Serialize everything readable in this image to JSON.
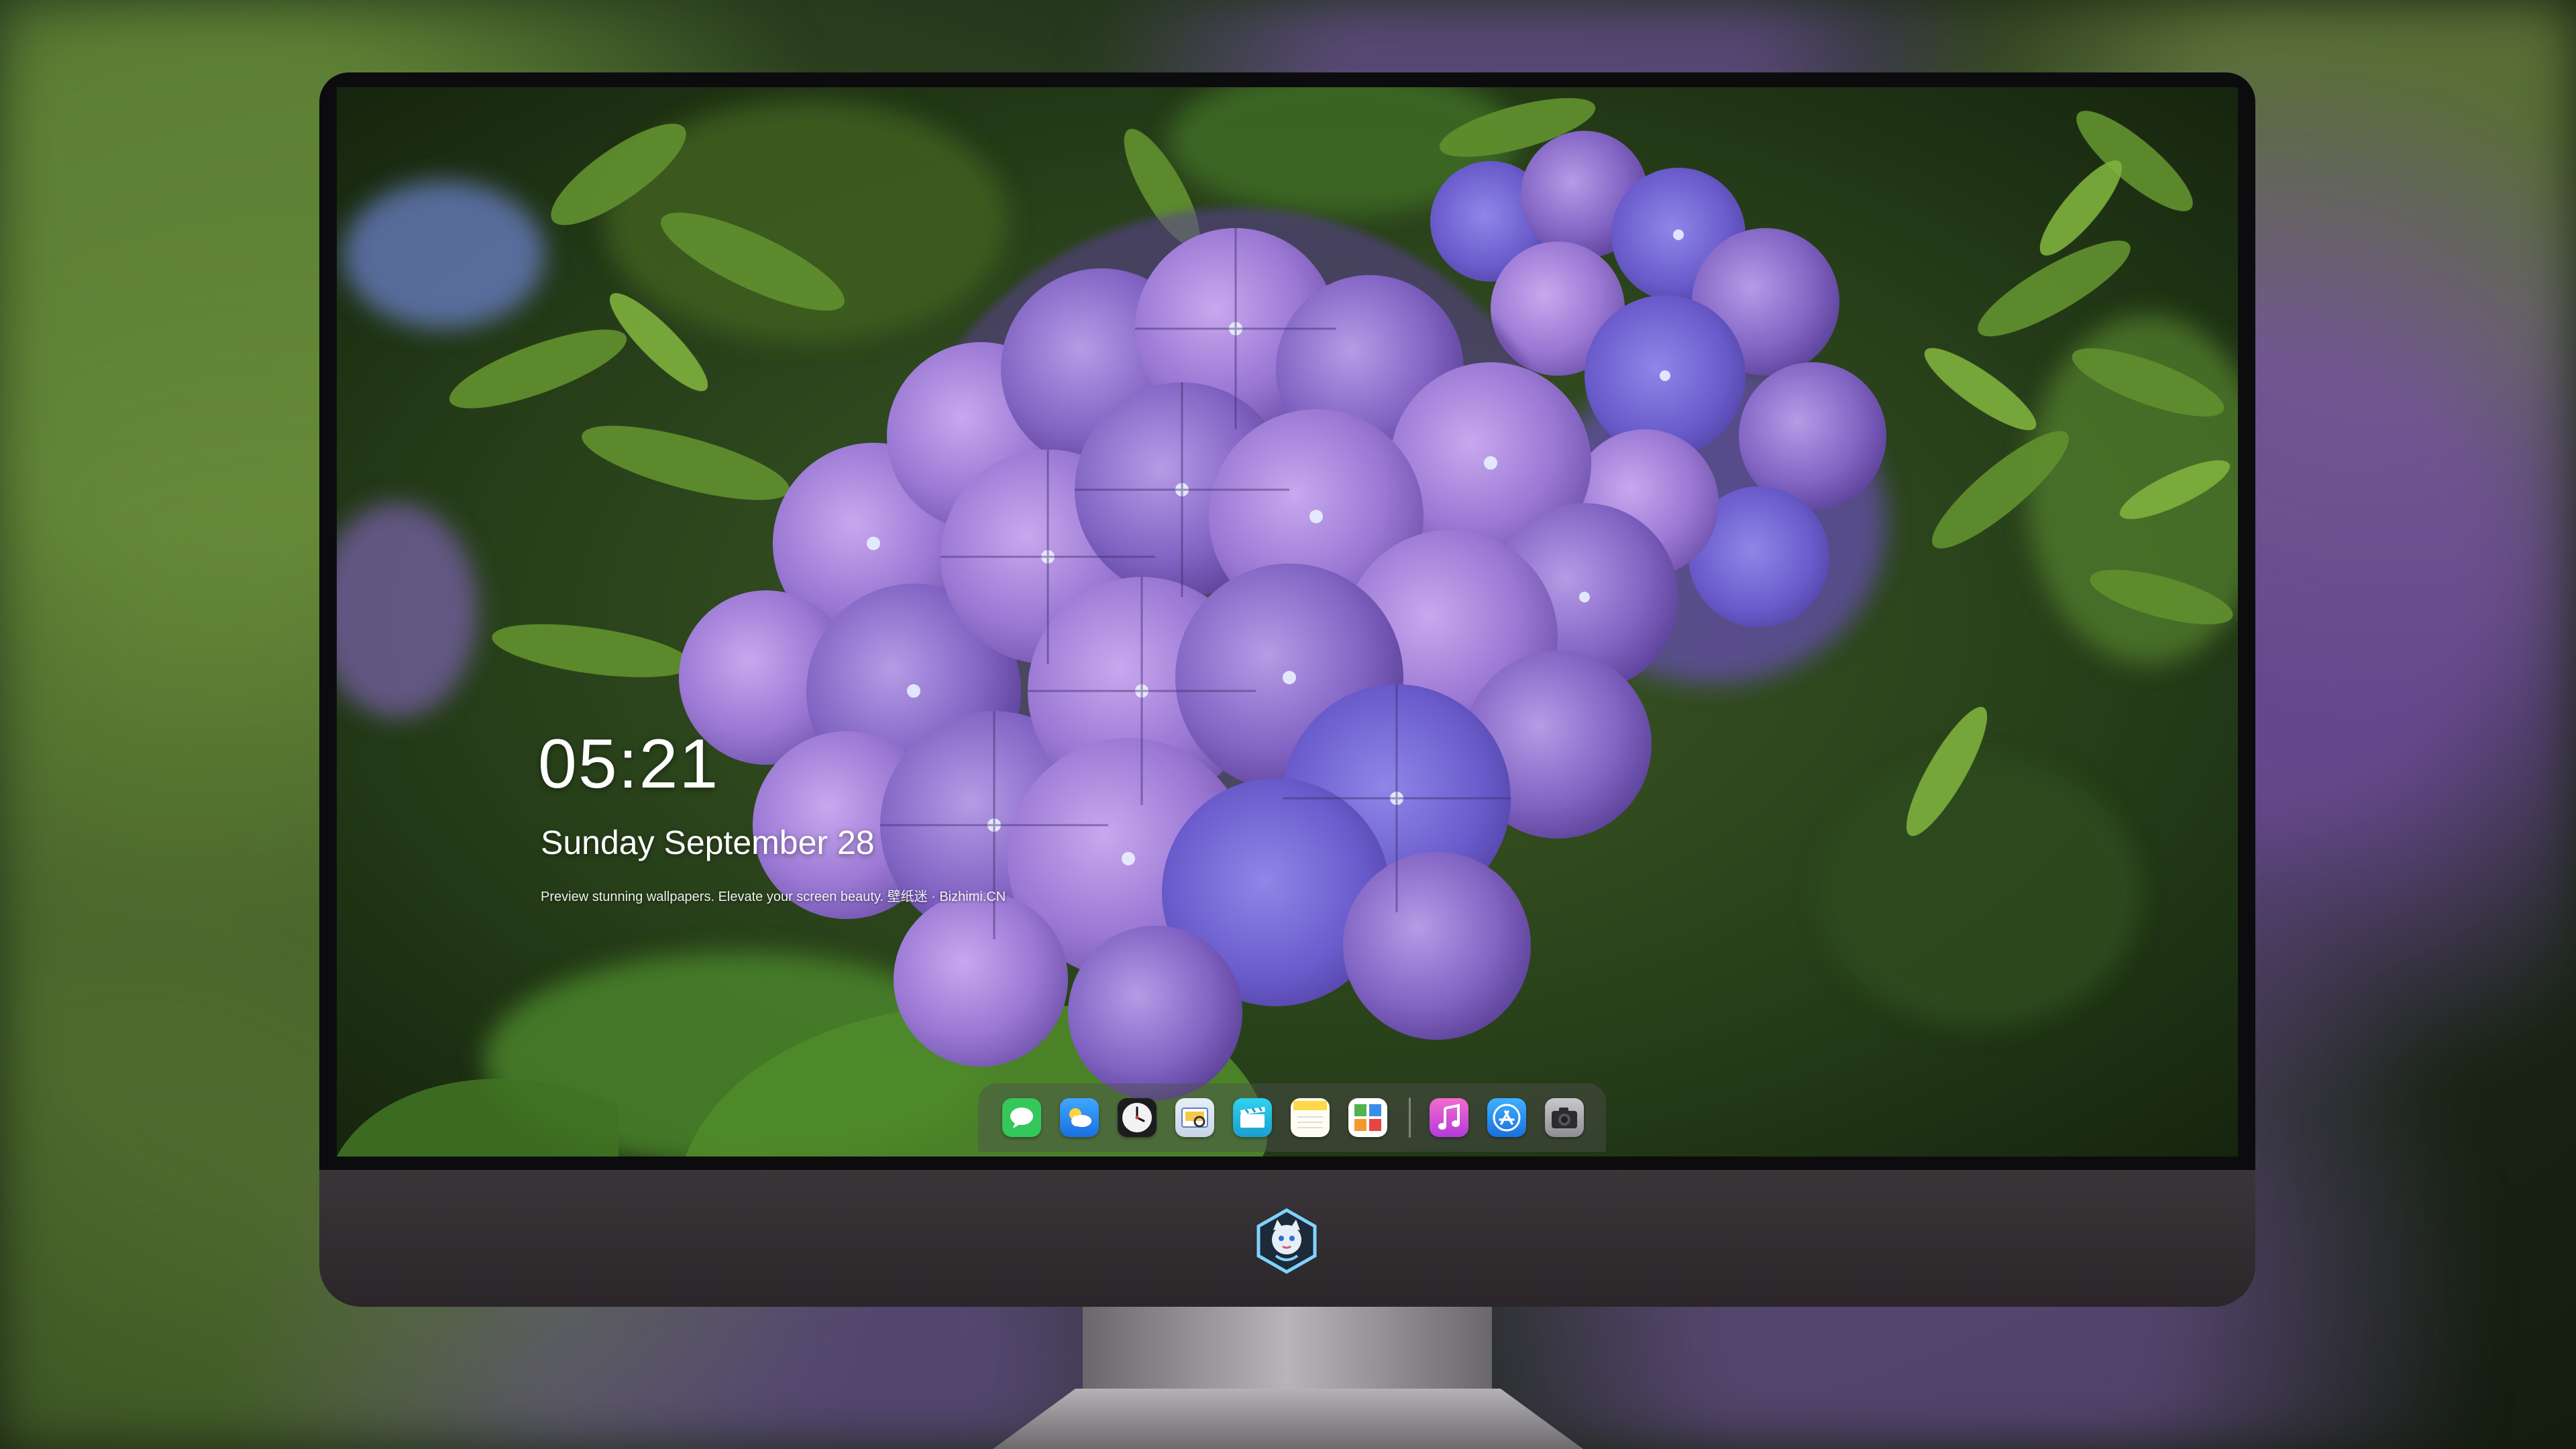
{
  "lock_screen": {
    "time": "05:21",
    "date": "Sunday September  28",
    "caption": "Preview stunning wallpapers. Elevate your screen beauty. 壁纸迷 · Bizhimi.CN"
  },
  "dock": {
    "apps": [
      {
        "name": "messages-icon",
        "color": "#34c759"
      },
      {
        "name": "weather-icon",
        "color": "#2a8cf4"
      },
      {
        "name": "clock-icon",
        "color": "#f2f2f2"
      },
      {
        "name": "preview-icon",
        "color": "#f5c84a"
      },
      {
        "name": "clips-icon",
        "color": "#1fc2e0"
      },
      {
        "name": "notes-icon",
        "color": "#ffd84a"
      },
      {
        "name": "photo-booth-icon",
        "color": "#4fb34f"
      },
      {
        "name": "itunes-icon",
        "color": "#e640b8"
      },
      {
        "name": "app-store-icon",
        "color": "#1a7ff0"
      },
      {
        "name": "camera-icon",
        "color": "#8e8e93"
      }
    ]
  },
  "brand": {
    "logo_icon": "character-badge-icon"
  }
}
